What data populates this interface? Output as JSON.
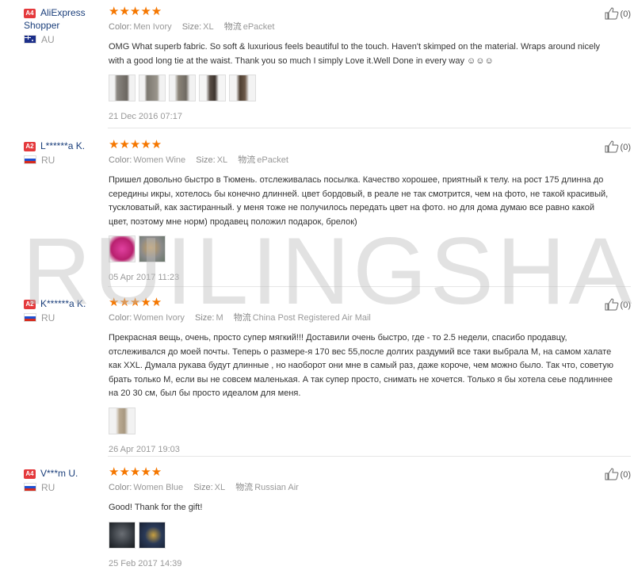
{
  "watermark": "RUILINGSHA",
  "colors": {
    "star": "#f57700",
    "level_badge": "#e4393c",
    "buyer_name": "#1b3f7b"
  },
  "reviews": [
    {
      "level": "A4",
      "name": "AliExpress Shopper",
      "country": "AU",
      "flag": "au-flag",
      "stars": "★★★★★",
      "color_label": "Color:",
      "color_value": "Men Ivory",
      "size_label": "Size:",
      "size_value": "XL",
      "shipping_label": "物流",
      "shipping_value": "ePacket",
      "text": "OMG What superb fabric. So soft & luxurious feels beautiful to the touch. Haven't skimped on the material. Wraps around nicely with a good long tie at the waist. Thank you so much I simply Love it.Well Done in every way ☺☺☺",
      "photo_count": 5,
      "date": "21 Dec 2016 07:17",
      "helpful": "(0)"
    },
    {
      "level": "A2",
      "name": "L******a K.",
      "country": "RU",
      "flag": "ru-flag",
      "stars": "★★★★★",
      "color_label": "Color:",
      "color_value": "Women Wine",
      "size_label": "Size:",
      "size_value": "XL",
      "shipping_label": "物流",
      "shipping_value": "ePacket",
      "text": "Пришел довольно быстро в Тюмень. отслеживалась посылка. Качество хорошее, приятный к телу. на рост 175 длинна до середины икры, хотелось бы конечно длинней. цвет бордовый, в реале не так смотрится, чем на фото, не такой красивый, тускловатый, как застиранный. у меня тоже не получилось передать цвет на фото. но для дома думаю все равно какой цвет, поэтому мне норм) продавец положил подарок, брелок)",
      "photo_count": 2,
      "date": "05 Apr 2017 11:23",
      "helpful": "(0)"
    },
    {
      "level": "A2",
      "name": "K******a K.",
      "country": "RU",
      "flag": "ru-flag",
      "stars": "★★★★★",
      "color_label": "Color:",
      "color_value": "Women Ivory",
      "size_label": "Size:",
      "size_value": "M",
      "shipping_label": "物流",
      "shipping_value": "China Post Registered Air Mail",
      "text": "Прекрасная вещь, очень, просто супер мягкий!!! Доставили очень быстро, где - то 2.5 недели, спасибо продавцу, отслеживался до моей почты. Теперь о размере-я 170 вес 55,после долгих раздумий все таки выбрала М, на самом халате как XXL. Думала рукава будут длинные , но наоборот они мне в самый раз, даже короче, чем можно было. Так что, советую брать только М, если вы не совсем маленькая. А так супер просто, снимать не хочется. Только я бы хотела сеье подлиннее на 20 30 см, был бы просто идеалом для меня.",
      "photo_count": 1,
      "date": "26 Apr 2017 19:03",
      "helpful": "(0)"
    },
    {
      "level": "A4",
      "name": "V***m U.",
      "country": "RU",
      "flag": "ru-flag",
      "stars": "★★★★★",
      "color_label": "Color:",
      "color_value": "Women Blue",
      "size_label": "Size:",
      "size_value": "XL",
      "shipping_label": "物流",
      "shipping_value": "Russian Air",
      "text": "Good! Thank for the gift!",
      "photo_count": 2,
      "date": "25 Feb 2017 14:39",
      "helpful": "(0)"
    }
  ]
}
